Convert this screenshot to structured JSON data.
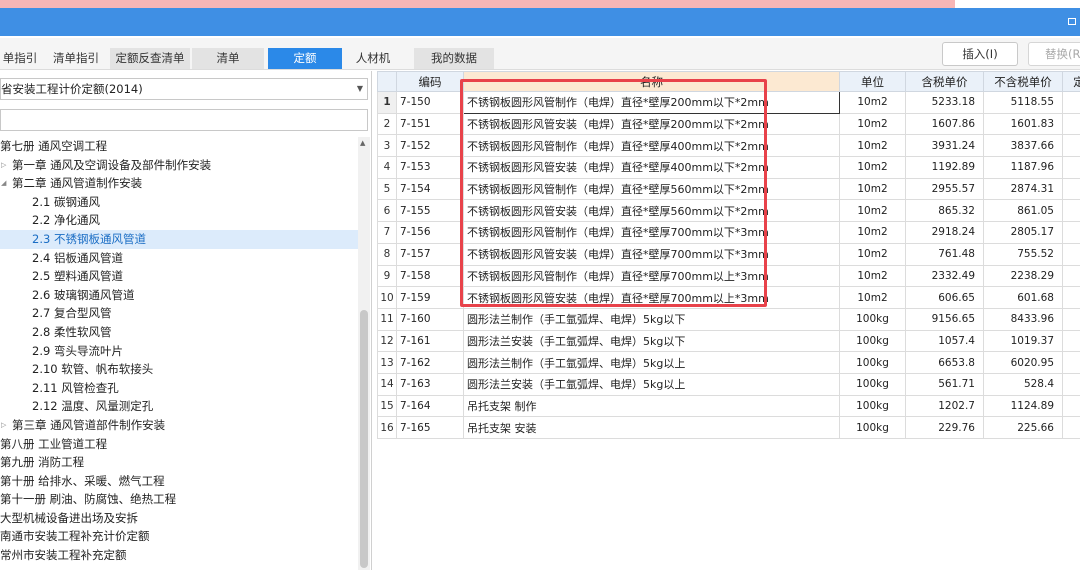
{
  "tabs": [
    {
      "label": "单指引",
      "active": false
    },
    {
      "label": "清单指引",
      "active": false
    },
    {
      "label": "定额反查清单",
      "active": false
    },
    {
      "label": "清单",
      "active": false
    },
    {
      "label": "定额",
      "active": true
    },
    {
      "label": "人材机",
      "active": false
    },
    {
      "label": "我的数据",
      "active": false
    }
  ],
  "toolbar": {
    "insert_label": "插入(I)",
    "replace_label": "替换(R"
  },
  "left": {
    "library_select": "省安装工程计价定额(2014)",
    "search_value": "",
    "tree": [
      {
        "label": "第七册 通风空调工程",
        "level": 0
      },
      {
        "label": "第一章 通风及空调设备及部件制作安装",
        "level": 1
      },
      {
        "label": "第二章 通风管道制作安装",
        "level": 1
      },
      {
        "label": "2.1 碳钢通风",
        "level": 2
      },
      {
        "label": "2.2 净化通风",
        "level": 2
      },
      {
        "label": "2.3 不锈钢板通风管道",
        "level": 2,
        "selected": true
      },
      {
        "label": "2.4 铝板通风管道",
        "level": 2
      },
      {
        "label": "2.5 塑料通风管道",
        "level": 2
      },
      {
        "label": "2.6 玻璃钢通风管道",
        "level": 2
      },
      {
        "label": "2.7 复合型风管",
        "level": 2
      },
      {
        "label": "2.8 柔性软风管",
        "level": 2
      },
      {
        "label": "2.9 弯头导流叶片",
        "level": 2
      },
      {
        "label": "2.10 软管、帆布软接头",
        "level": 2
      },
      {
        "label": "2.11 风管检查孔",
        "level": 2
      },
      {
        "label": "2.12 温度、风量测定孔",
        "level": 2
      },
      {
        "label": "第三章 通风管道部件制作安装",
        "level": 1
      },
      {
        "label": "第八册 工业管道工程",
        "level": 0
      },
      {
        "label": "第九册 消防工程",
        "level": 0
      },
      {
        "label": "第十册 给排水、采暖、燃气工程",
        "level": 0
      },
      {
        "label": "第十一册 刷油、防腐蚀、绝热工程",
        "level": 0
      },
      {
        "label": "大型机械设备进出场及安拆",
        "level": 0
      },
      {
        "label": "南通市安装工程补充计价定额",
        "level": 0
      },
      {
        "label": "常州市安装工程补充定额",
        "level": 0
      }
    ]
  },
  "grid": {
    "headers": [
      "",
      "编码",
      "名称",
      "单位",
      "含税单价",
      "不含税单价",
      "定"
    ],
    "rows": [
      {
        "idx": "1",
        "code": "7-150",
        "name": "不锈钢板圆形风管制作（电焊）直径*壁厚200mm以下*2mm",
        "unit": "10m2",
        "tax_price": "5233.18",
        "notax_price": "5118.55"
      },
      {
        "idx": "2",
        "code": "7-151",
        "name": "不锈钢板圆形风管安装（电焊）直径*壁厚200mm以下*2mm",
        "unit": "10m2",
        "tax_price": "1607.86",
        "notax_price": "1601.83"
      },
      {
        "idx": "3",
        "code": "7-152",
        "name": "不锈钢板圆形风管制作（电焊）直径*壁厚400mm以下*2mm",
        "unit": "10m2",
        "tax_price": "3931.24",
        "notax_price": "3837.66"
      },
      {
        "idx": "4",
        "code": "7-153",
        "name": "不锈钢板圆形风管安装（电焊）直径*壁厚400mm以下*2mm",
        "unit": "10m2",
        "tax_price": "1192.89",
        "notax_price": "1187.96"
      },
      {
        "idx": "5",
        "code": "7-154",
        "name": "不锈钢板圆形风管制作（电焊）直径*壁厚560mm以下*2mm",
        "unit": "10m2",
        "tax_price": "2955.57",
        "notax_price": "2874.31"
      },
      {
        "idx": "6",
        "code": "7-155",
        "name": "不锈钢板圆形风管安装（电焊）直径*壁厚560mm以下*2mm",
        "unit": "10m2",
        "tax_price": "865.32",
        "notax_price": "861.05"
      },
      {
        "idx": "7",
        "code": "7-156",
        "name": "不锈钢板圆形风管制作（电焊）直径*壁厚700mm以下*3mm",
        "unit": "10m2",
        "tax_price": "2918.24",
        "notax_price": "2805.17"
      },
      {
        "idx": "8",
        "code": "7-157",
        "name": "不锈钢板圆形风管安装（电焊）直径*壁厚700mm以下*3mm",
        "unit": "10m2",
        "tax_price": "761.48",
        "notax_price": "755.52"
      },
      {
        "idx": "9",
        "code": "7-158",
        "name": "不锈钢板圆形风管制作（电焊）直径*壁厚700mm以上*3mm",
        "unit": "10m2",
        "tax_price": "2332.49",
        "notax_price": "2238.29"
      },
      {
        "idx": "10",
        "code": "7-159",
        "name": "不锈钢板圆形风管安装（电焊）直径*壁厚700mm以上*3mm",
        "unit": "10m2",
        "tax_price": "606.65",
        "notax_price": "601.68"
      },
      {
        "idx": "11",
        "code": "7-160",
        "name": "圆形法兰制作（手工氩弧焊、电焊）5kg以下",
        "unit": "100kg",
        "tax_price": "9156.65",
        "notax_price": "8433.96"
      },
      {
        "idx": "12",
        "code": "7-161",
        "name": "圆形法兰安装（手工氩弧焊、电焊）5kg以下",
        "unit": "100kg",
        "tax_price": "1057.4",
        "notax_price": "1019.37"
      },
      {
        "idx": "13",
        "code": "7-162",
        "name": "圆形法兰制作（手工氩弧焊、电焊）5kg以上",
        "unit": "100kg",
        "tax_price": "6653.8",
        "notax_price": "6020.95"
      },
      {
        "idx": "14",
        "code": "7-163",
        "name": "圆形法兰安装（手工氩弧焊、电焊）5kg以上",
        "unit": "100kg",
        "tax_price": "561.71",
        "notax_price": "528.4"
      },
      {
        "idx": "15",
        "code": "7-164",
        "name": "吊托支架 制作",
        "unit": "100kg",
        "tax_price": "1202.7",
        "notax_price": "1124.89"
      },
      {
        "idx": "16",
        "code": "7-165",
        "name": "吊托支架 安装",
        "unit": "100kg",
        "tax_price": "229.76",
        "notax_price": "225.66"
      }
    ]
  },
  "colors": {
    "accent": "#2b89e8",
    "titlebar": "#3f8fe4",
    "highlight": "#e8424a",
    "selected_tree": "#dcebfb"
  }
}
